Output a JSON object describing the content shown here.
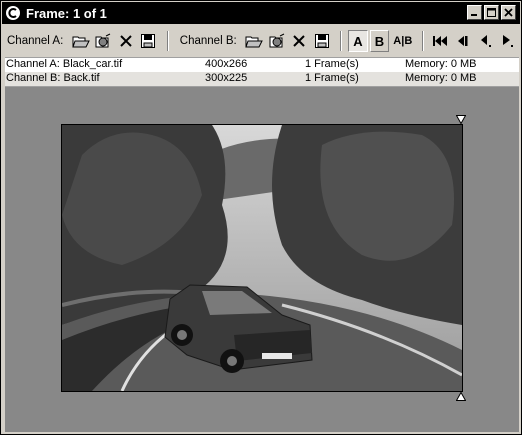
{
  "window": {
    "title": "Frame: 1 of 1"
  },
  "toolbar": {
    "channel_a_label": "Channel A:",
    "channel_b_label": "Channel B:",
    "btn_a": "A",
    "btn_b": "B",
    "btn_ab": "A|B"
  },
  "channels": [
    {
      "name": "Channel A: Black_car.tif",
      "size": "400x266",
      "frames": "1 Frame(s)",
      "memory": "Memory: 0 MB"
    },
    {
      "name": "Channel B: Back.tif",
      "size": "300x225",
      "frames": "1 Frame(s)",
      "memory": "Memory: 0 MB"
    }
  ],
  "colors": {
    "title_bg": "#000000",
    "panel": "#d4d0c8",
    "viewport": "#888888"
  },
  "icons": [
    "app-icon",
    "minimize-icon",
    "maximize-icon",
    "close-icon",
    "open-folder-icon",
    "open-sequence-icon",
    "clear-icon",
    "save-icon",
    "first-frame-icon",
    "prev-frame-icon",
    "prev-key-icon",
    "play-icon"
  ]
}
